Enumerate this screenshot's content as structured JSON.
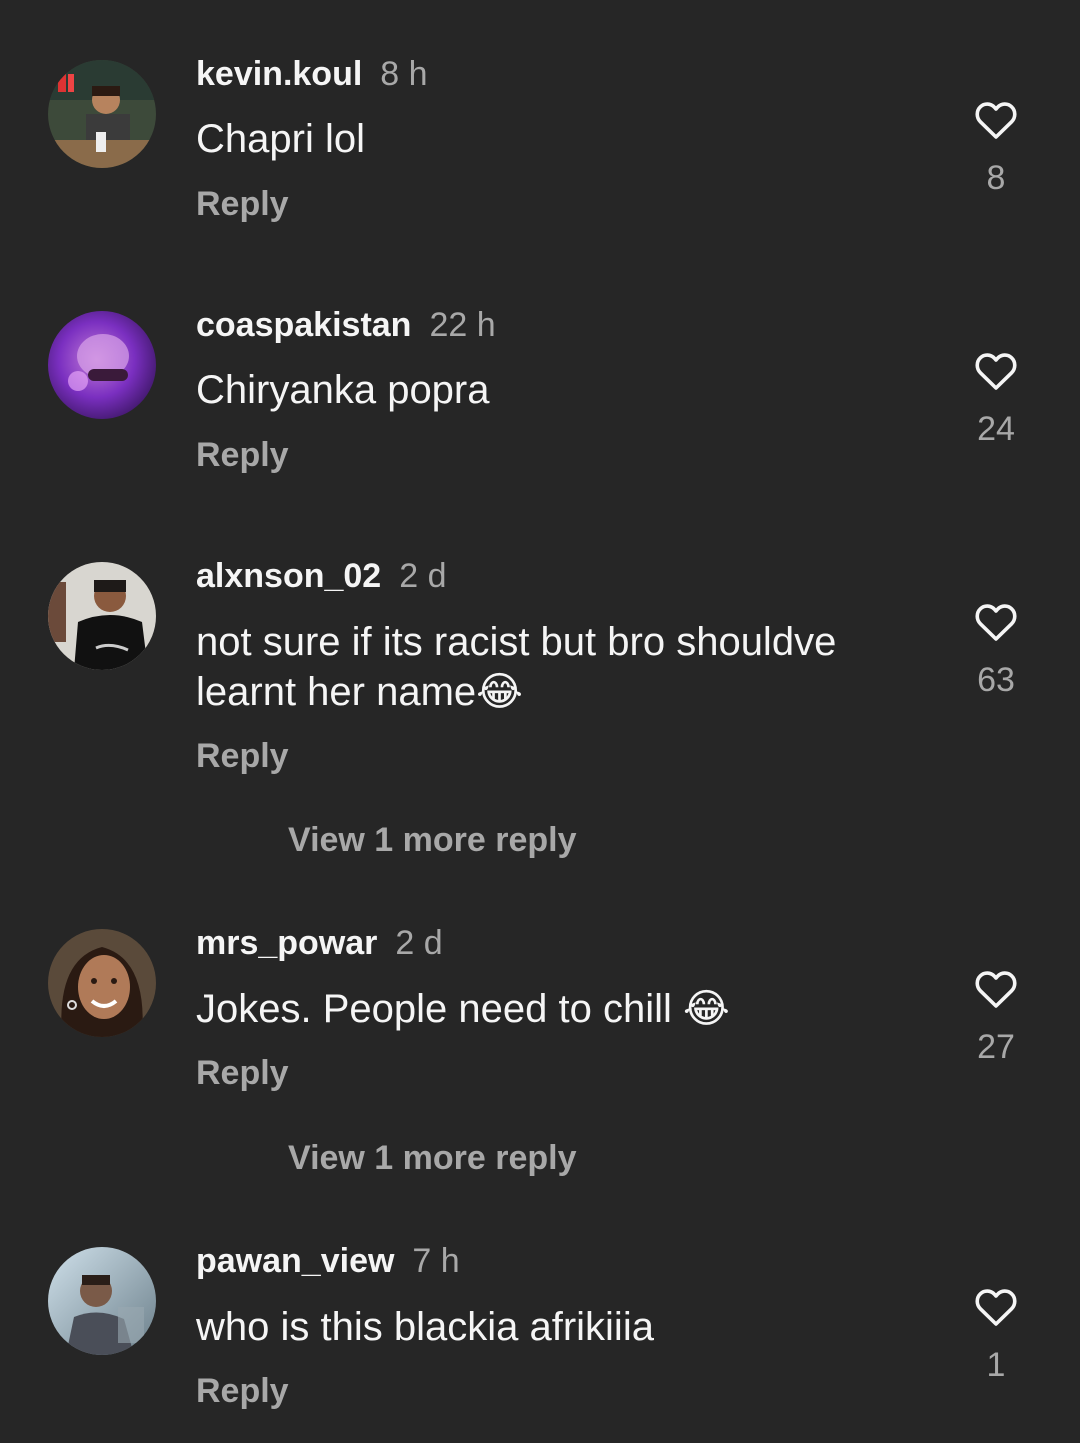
{
  "comments": [
    {
      "username": "kevin.koul",
      "time": "8 h",
      "text": "Chapri lol",
      "reply_label": "Reply",
      "likes": "8"
    },
    {
      "username": "coaspakistan",
      "time": "22 h",
      "text": "Chiryanka popra",
      "reply_label": "Reply",
      "likes": "24"
    },
    {
      "username": "alxnson_02",
      "time": "2 d",
      "text": "not sure if its racist but bro shouldve learnt her name😂",
      "reply_label": "Reply",
      "likes": "63",
      "more_replies": "View 1 more reply"
    },
    {
      "username": "mrs_powar",
      "time": "2 d",
      "text": "Jokes. People need to chill 😂",
      "reply_label": "Reply",
      "likes": "27",
      "more_replies": "View 1 more reply"
    },
    {
      "username": "pawan_view",
      "time": "7 h",
      "text": "who is this blackia afrikiiia",
      "reply_label": "Reply",
      "likes": "1"
    }
  ],
  "icons": {
    "like": "heart-outline-icon"
  },
  "colors": {
    "background": "#262626",
    "primary_text": "#f5f5f5",
    "secondary_text": "#a8a8a8"
  }
}
